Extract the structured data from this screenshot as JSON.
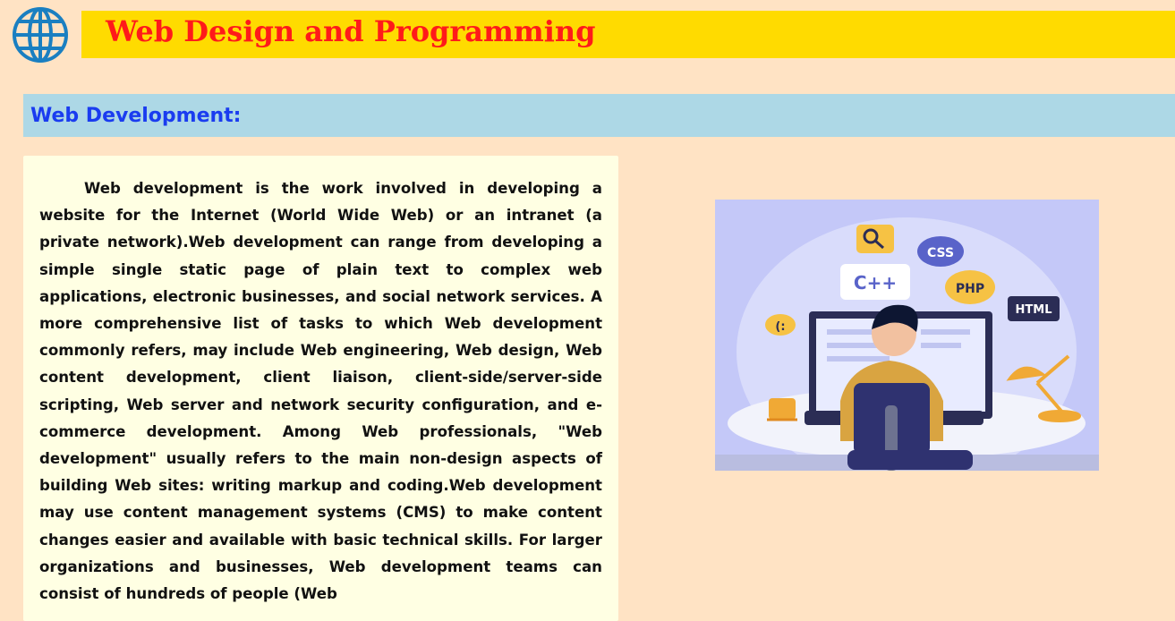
{
  "header": {
    "title": "Web Design and Programming",
    "logo_icon": "globe-icon"
  },
  "section": {
    "title": "Web Development:"
  },
  "content": {
    "paragraph": "Web development is the work involved in developing a website for the Internet (World Wide Web) or an intranet (a private network).Web development can range from developing a simple single static page of plain text to complex web applications, electronic businesses, and social network services. A more comprehensive list of tasks to which Web development commonly refers, may include Web engineering, Web design, Web content development, client liaison, client-side/server-side scripting, Web server and network security configuration, and e-commerce development. Among Web professionals, \"Web development\" usually refers to the main non-design aspects of building Web sites: writing markup and coding.Web development may use content management systems (CMS) to make content changes easier and available with basic technical skills. For larger organizations and businesses, Web development teams can consist of hundreds of people (Web"
  },
  "illustration": {
    "bubbles": {
      "cpp": "C++",
      "css": "CSS",
      "php": "PHP",
      "html": "HTML",
      "emoticon": "(:"
    },
    "icons": [
      "magnifier-icon",
      "coffee-cup-icon",
      "desk-lamp-icon"
    ]
  },
  "colors": {
    "page_bg": "#ffe3c4",
    "title_bar": "#ffdb00",
    "title_text": "#ff1a1a",
    "section_bar": "#add8e6",
    "section_text": "#1a3cf0",
    "card_bg": "#ffffe3",
    "logo_blue": "#1a7fc1"
  }
}
